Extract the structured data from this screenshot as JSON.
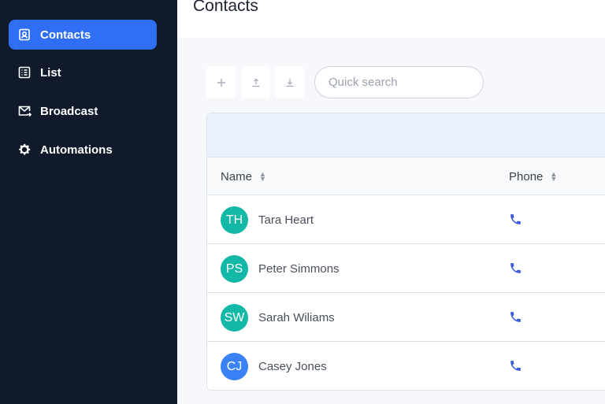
{
  "sidebar": {
    "items": [
      {
        "label": "Contacts",
        "icon": "contact-card-icon",
        "active": true
      },
      {
        "label": "List",
        "icon": "list-icon",
        "active": false
      },
      {
        "label": "Broadcast",
        "icon": "mail-send-icon",
        "active": false
      },
      {
        "label": "Automations",
        "icon": "gear-icon",
        "active": false
      }
    ]
  },
  "header": {
    "title": "Contacts"
  },
  "toolbar": {
    "add_icon": "plus-icon",
    "upload_icon": "upload-icon",
    "download_icon": "download-icon",
    "search_placeholder": "Quick search"
  },
  "table": {
    "columns": [
      {
        "label": "Name"
      },
      {
        "label": "Phone"
      }
    ],
    "rows": [
      {
        "initials": "TH",
        "name": "Tara Heart",
        "avatar_color": "#14b8a6"
      },
      {
        "initials": "PS",
        "name": "Peter Simmons",
        "avatar_color": "#14b8a6"
      },
      {
        "initials": "SW",
        "name": "Sarah Wiliams",
        "avatar_color": "#14b8a6"
      },
      {
        "initials": "CJ",
        "name": "Casey Jones",
        "avatar_color": "#3b82f6"
      }
    ]
  },
  "colors": {
    "sidebar_bg": "#111a2b",
    "accent": "#2f6ef5",
    "phone_icon": "#3b5bdb"
  }
}
